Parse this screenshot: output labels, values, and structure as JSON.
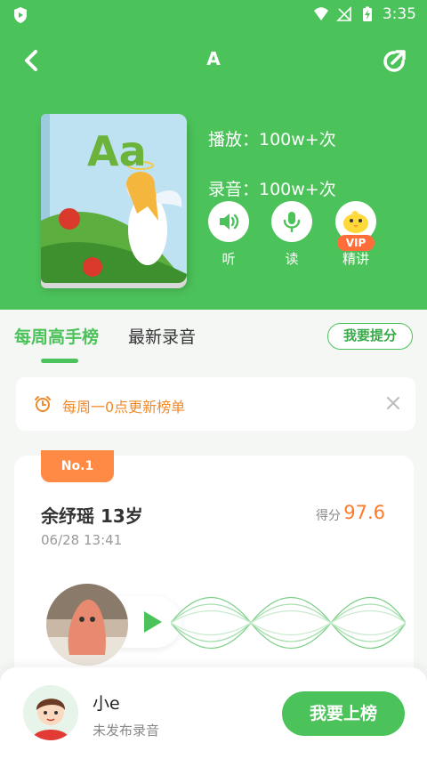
{
  "status_bar": {
    "time": "3:35"
  },
  "nav": {
    "title": "A"
  },
  "book": {
    "letters": "Aa"
  },
  "stats": {
    "plays": "播放：100w+次",
    "recordings": "录音：100w+次"
  },
  "actions": {
    "listen": "听",
    "read": "读",
    "lecture": "精讲",
    "vip_badge": "VIP"
  },
  "tabs": {
    "weekly": "每周高手榜",
    "latest": "最新录音",
    "improve_button": "我要提分"
  },
  "notice": {
    "text": "每周一0点更新榜单"
  },
  "entry": {
    "rank": "No.1",
    "name": "余纾瑶   13岁",
    "date": "06/28 13:41",
    "score_label": "得分",
    "score": "97.6"
  },
  "me": {
    "name": "小e",
    "status": "未发布录音",
    "rank_button": "我要上榜"
  },
  "colors": {
    "primary": "#4cc35a",
    "accent": "#ff8a45",
    "notice": "#f08a2c"
  }
}
